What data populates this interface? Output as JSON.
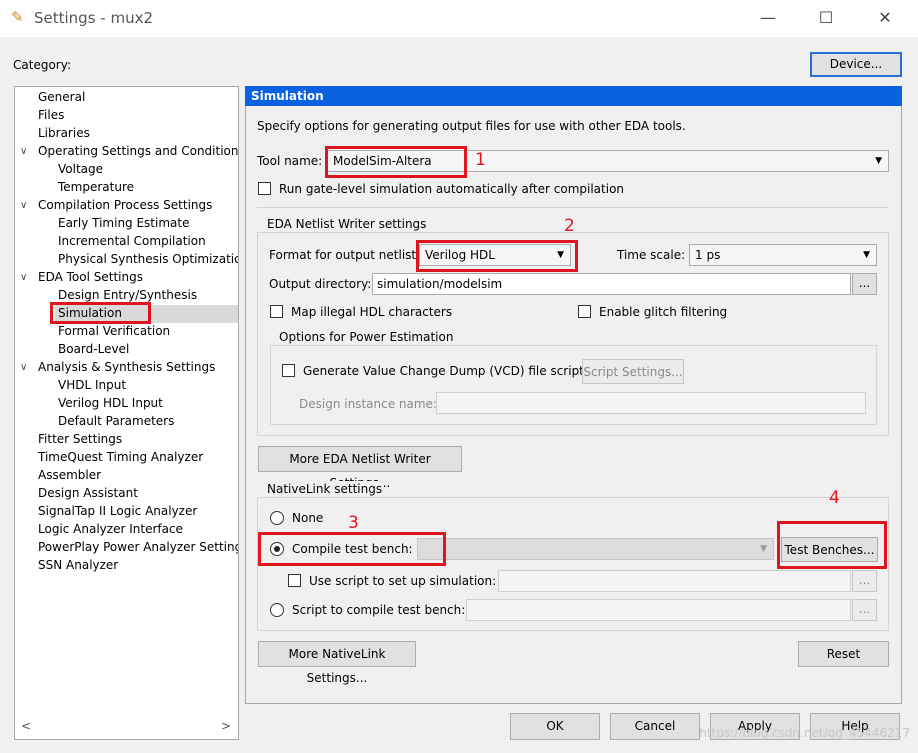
{
  "window": {
    "title": "Settings - mux2",
    "minimize_label": "—",
    "maximize_label": "☐",
    "close_label": "✕"
  },
  "category_label": "Category:",
  "device_button": "Device...",
  "tree": {
    "items": [
      {
        "label": "General",
        "level": 1,
        "expander": false
      },
      {
        "label": "Files",
        "level": 1,
        "expander": false
      },
      {
        "label": "Libraries",
        "level": 1,
        "expander": false
      },
      {
        "label": "Operating Settings and Conditions",
        "level": 1,
        "expander": true
      },
      {
        "label": "Voltage",
        "level": 2,
        "expander": false
      },
      {
        "label": "Temperature",
        "level": 2,
        "expander": false
      },
      {
        "label": "Compilation Process Settings",
        "level": 1,
        "expander": true
      },
      {
        "label": "Early Timing Estimate",
        "level": 2,
        "expander": false
      },
      {
        "label": "Incremental Compilation",
        "level": 2,
        "expander": false
      },
      {
        "label": "Physical Synthesis Optimization",
        "level": 2,
        "expander": false
      },
      {
        "label": "EDA Tool Settings",
        "level": 1,
        "expander": true
      },
      {
        "label": "Design Entry/Synthesis",
        "level": 2,
        "expander": false
      },
      {
        "label": "Simulation",
        "level": 2,
        "expander": false,
        "selected": true
      },
      {
        "label": "Formal Verification",
        "level": 2,
        "expander": false
      },
      {
        "label": "Board-Level",
        "level": 2,
        "expander": false
      },
      {
        "label": "Analysis & Synthesis Settings",
        "level": 1,
        "expander": true
      },
      {
        "label": "VHDL Input",
        "level": 2,
        "expander": false
      },
      {
        "label": "Verilog HDL Input",
        "level": 2,
        "expander": false
      },
      {
        "label": "Default Parameters",
        "level": 2,
        "expander": false
      },
      {
        "label": "Fitter Settings",
        "level": 1,
        "expander": false
      },
      {
        "label": "TimeQuest Timing Analyzer",
        "level": 1,
        "expander": false
      },
      {
        "label": "Assembler",
        "level": 1,
        "expander": false
      },
      {
        "label": "Design Assistant",
        "level": 1,
        "expander": false
      },
      {
        "label": "SignalTap II Logic Analyzer",
        "level": 1,
        "expander": false
      },
      {
        "label": "Logic Analyzer Interface",
        "level": 1,
        "expander": false
      },
      {
        "label": "PowerPlay Power Analyzer Settings",
        "level": 1,
        "expander": false
      },
      {
        "label": "SSN Analyzer",
        "level": 1,
        "expander": false
      }
    ],
    "scroll_left": "<",
    "scroll_right": ">"
  },
  "panel": {
    "title": "Simulation",
    "description": "Specify options for generating output files for use with other EDA tools.",
    "tool_name_label": "Tool name:",
    "tool_name_value": "ModelSim-Altera",
    "run_gate_level_label": "Run gate-level simulation automatically after compilation",
    "eda_netlist": {
      "group_label": "EDA Netlist Writer settings",
      "format_label": "Format for output netlist:",
      "format_value": "Verilog HDL",
      "time_scale_label": "Time scale:",
      "time_scale_value": "1 ps",
      "output_dir_label": "Output directory:",
      "output_dir_value": "simulation/modelsim",
      "browse_label": "...",
      "map_illegal_label": "Map illegal HDL characters",
      "glitch_label": "Enable glitch filtering",
      "power_group_label": "Options for Power Estimation",
      "vcd_label": "Generate Value Change Dump (VCD) file script",
      "script_settings_label": "Script Settings...",
      "design_instance_label": "Design instance name:"
    },
    "more_eda_button": "More EDA Netlist Writer Settings...",
    "nativelink": {
      "group_label": "NativeLink settings",
      "none_label": "None",
      "compile_tb_label": "Compile test bench:",
      "test_benches_button": "Test Benches...",
      "use_script_label": "Use script to set up simulation:",
      "script_compile_label": "Script to compile test bench:",
      "browse_label": "..."
    },
    "more_nativelink_button": "More NativeLink Settings...",
    "reset_button": "Reset"
  },
  "footer": {
    "ok": "OK",
    "cancel": "Cancel",
    "apply": "Apply",
    "help": "Help"
  },
  "annotations": {
    "n1": "1",
    "n2": "2",
    "n3": "3",
    "n4": "4"
  },
  "watermark": "https://blog.csdn.net/qq_45446217",
  "colors": {
    "header_blue": "#0a62e3",
    "annotation_red": "#e0141e",
    "selection_gray": "#d9d9d9"
  }
}
